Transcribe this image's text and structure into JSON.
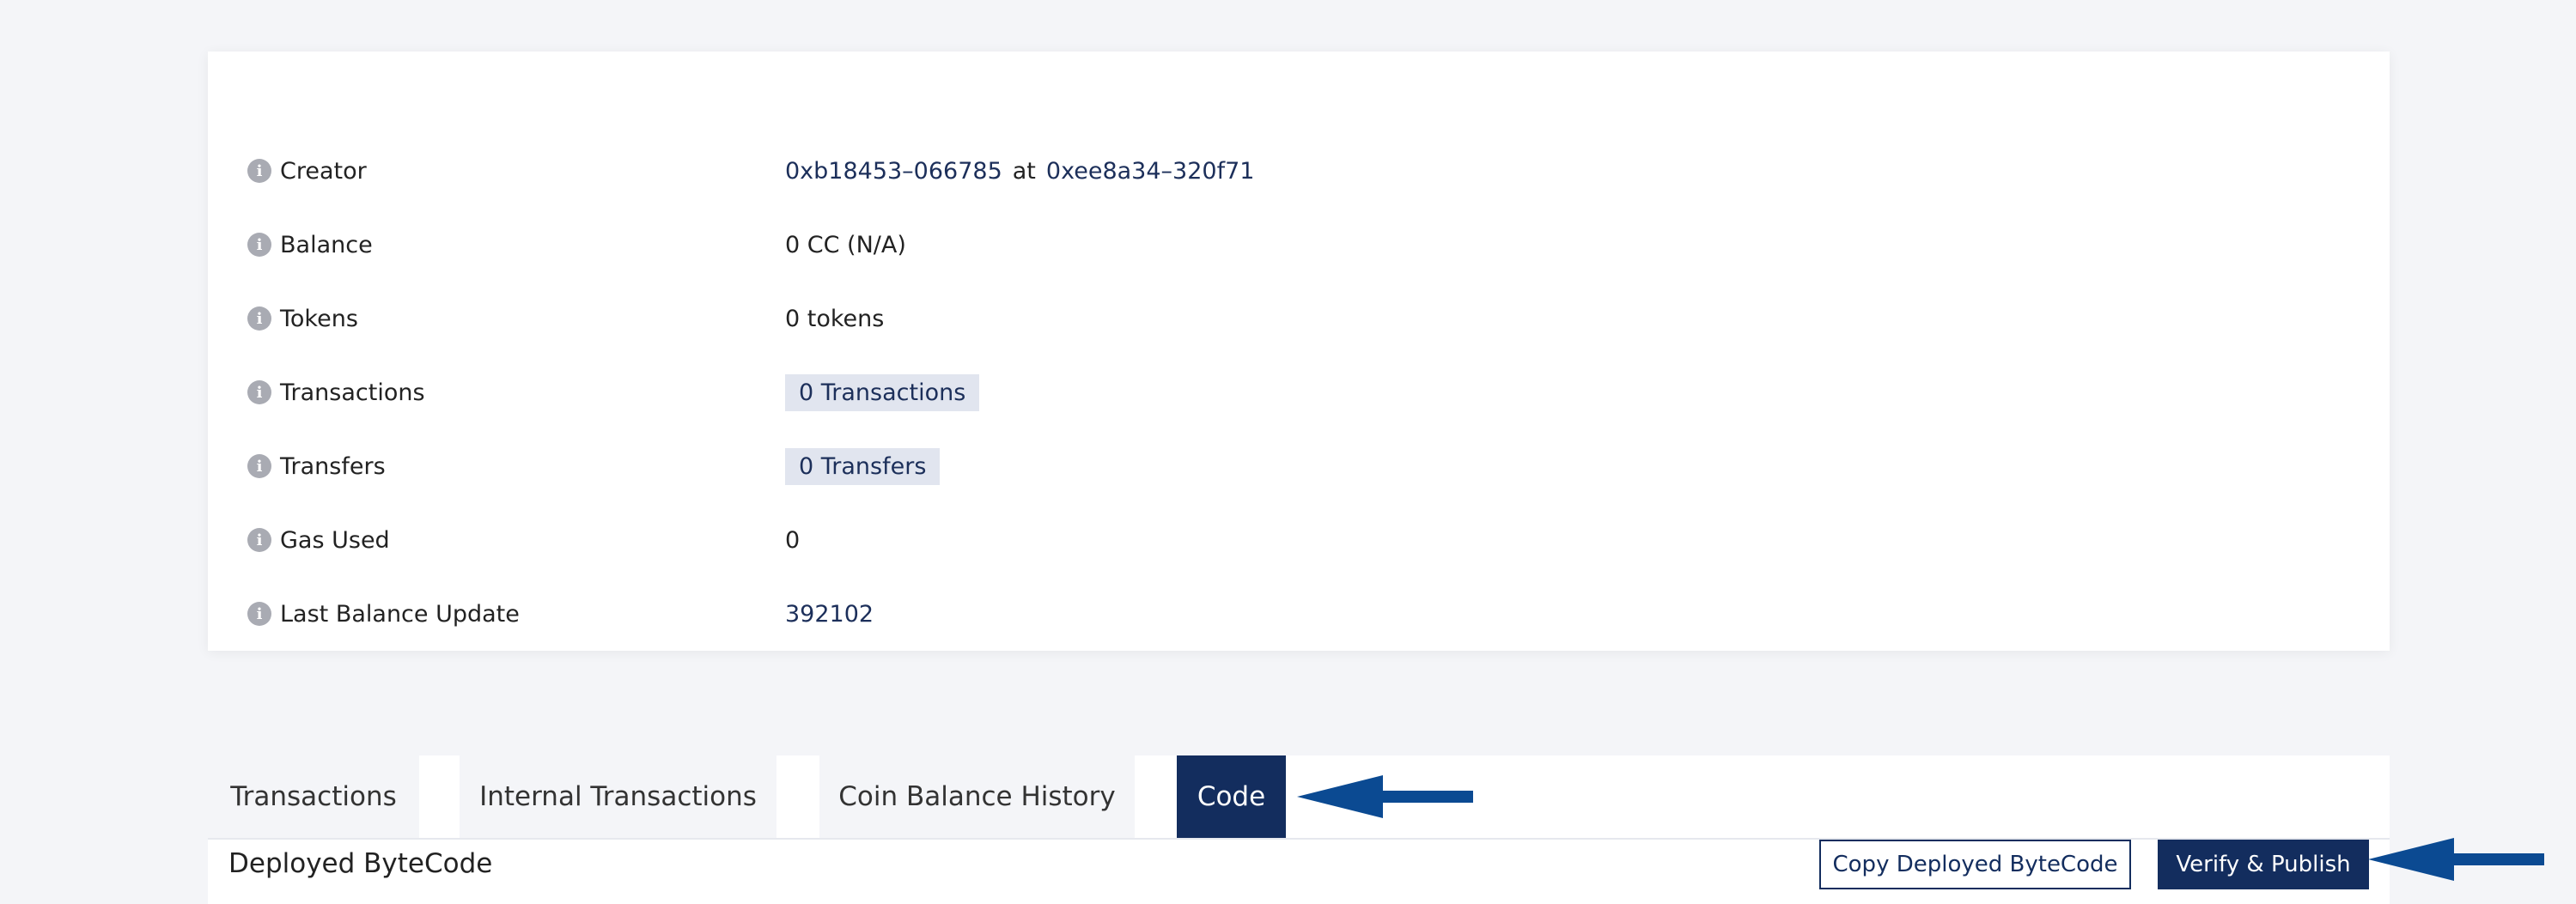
{
  "details": [
    {
      "key": "creator",
      "label": "Creator",
      "value_type": "creator",
      "address": "0xb18453–066785",
      "between": "at",
      "tx": "0xee8a34–320f71"
    },
    {
      "key": "balance",
      "label": "Balance",
      "value_type": "plain",
      "value": "0 CC (N/A)"
    },
    {
      "key": "tokens",
      "label": "Tokens",
      "value_type": "plain",
      "value": "0 tokens"
    },
    {
      "key": "transactions",
      "label": "Transactions",
      "value_type": "pill",
      "value": "0 Transactions"
    },
    {
      "key": "transfers",
      "label": "Transfers",
      "value_type": "pill",
      "value": "0 Transfers"
    },
    {
      "key": "gas-used",
      "label": "Gas Used",
      "value_type": "plain",
      "value": "0"
    },
    {
      "key": "last-balance-update",
      "label": "Last Balance Update",
      "value_type": "link",
      "value": "392102"
    }
  ],
  "info_icon": "info-circle-icon",
  "tabs": [
    {
      "label": "Transactions",
      "active": false
    },
    {
      "label": "Internal Transactions",
      "active": false
    },
    {
      "label": "Coin Balance History",
      "active": false
    },
    {
      "label": "Code",
      "active": true
    }
  ],
  "code_section": {
    "title": "Deployed ByteCode",
    "copy_button": "Copy Deployed ByteCode",
    "verify_button": "Verify & Publish"
  },
  "colors": {
    "accent": "#132d5e",
    "link": "#1c2f5a",
    "pill_bg": "#e1e5ef",
    "annotation_arrow": "#0b4a92",
    "page_bg": "#f4f5f8"
  }
}
